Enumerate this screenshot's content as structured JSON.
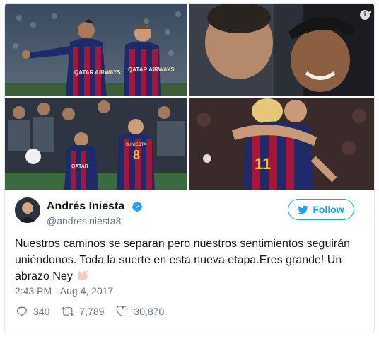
{
  "media": {
    "photos": [
      {
        "alt": "photo-1"
      },
      {
        "alt": "photo-2"
      },
      {
        "alt": "photo-3"
      },
      {
        "alt": "photo-4"
      }
    ],
    "jersey_text": {
      "sponsor_left": "QATAR AIRWAYS",
      "sponsor_right": "QATAR AIRWAYS",
      "back_name": "D.INIESTA",
      "back_number": "8",
      "front_sponsor": "QATAR",
      "front_number": "11"
    }
  },
  "author": {
    "name": "Andrés Iniesta",
    "handle": "@andresiniesta8",
    "verified": true
  },
  "follow_label": "Follow",
  "tweet": {
    "text": "Nuestros caminos se separan pero nuestros sentimientos seguirán uniéndonos. Toda la suerte en esta nueva etapa.Eres grande! Un abrazo Ney",
    "emoji": "call-me-hand"
  },
  "timestamp": "2:43 PM - Aug 4, 2017",
  "stats": {
    "replies": "340",
    "retweets": "7,789",
    "likes": "30,870"
  },
  "colors": {
    "accent": "#1da1f2",
    "muted": "#657786",
    "text": "#14171a",
    "border": "#e1e8ed"
  }
}
